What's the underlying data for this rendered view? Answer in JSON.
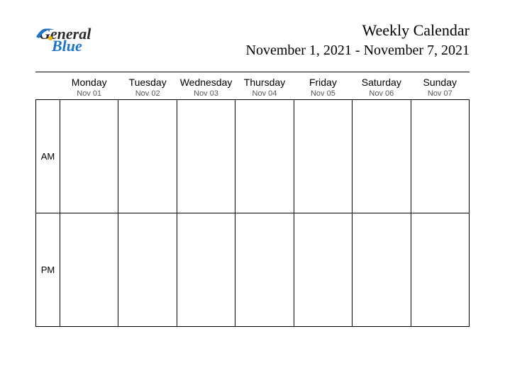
{
  "logo": {
    "part1": "General",
    "part2": "Blue"
  },
  "title": "Weekly Calendar",
  "range": "November 1, 2021 - November 7, 2021",
  "periods": {
    "am": "AM",
    "pm": "PM"
  },
  "days": [
    {
      "name": "Monday",
      "date": "Nov 01"
    },
    {
      "name": "Tuesday",
      "date": "Nov 02"
    },
    {
      "name": "Wednesday",
      "date": "Nov 03"
    },
    {
      "name": "Thursday",
      "date": "Nov 04"
    },
    {
      "name": "Friday",
      "date": "Nov 05"
    },
    {
      "name": "Saturday",
      "date": "Nov 06"
    },
    {
      "name": "Sunday",
      "date": "Nov 07"
    }
  ]
}
